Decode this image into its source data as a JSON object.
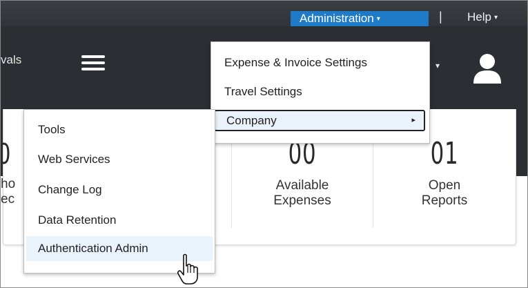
{
  "header": {
    "administration_label": "Administration",
    "help_label": "Help",
    "separator": "|",
    "caret": "▾"
  },
  "nav": {
    "approvals_fragment": "vals",
    "menu_icon": "hamburger-icon",
    "user_icon": "user-icon",
    "user_caret": "▾"
  },
  "admin_menu": {
    "items": [
      {
        "label": "Expense & Invoice Settings"
      },
      {
        "label": "Travel Settings"
      },
      {
        "label": "Company",
        "submenu_arrow": "▸"
      }
    ]
  },
  "company_menu": {
    "items": [
      {
        "label": "Tools"
      },
      {
        "label": "Web Services"
      },
      {
        "label": "Change Log"
      },
      {
        "label": "Data Retention"
      },
      {
        "label": "Authentication Admin"
      }
    ]
  },
  "tiles": [
    {
      "number": "0",
      "label_line1": "ho",
      "label_line2": "ec"
    },
    {
      "number": "00",
      "label_line1": "Available",
      "label_line2": "Expenses"
    },
    {
      "number": "01",
      "label_line1": "Open",
      "label_line2": "Reports"
    }
  ],
  "colors": {
    "admin_button": "#1f7bc8",
    "nav_background": "#2b2e33",
    "highlight": "#eaf3fb"
  }
}
